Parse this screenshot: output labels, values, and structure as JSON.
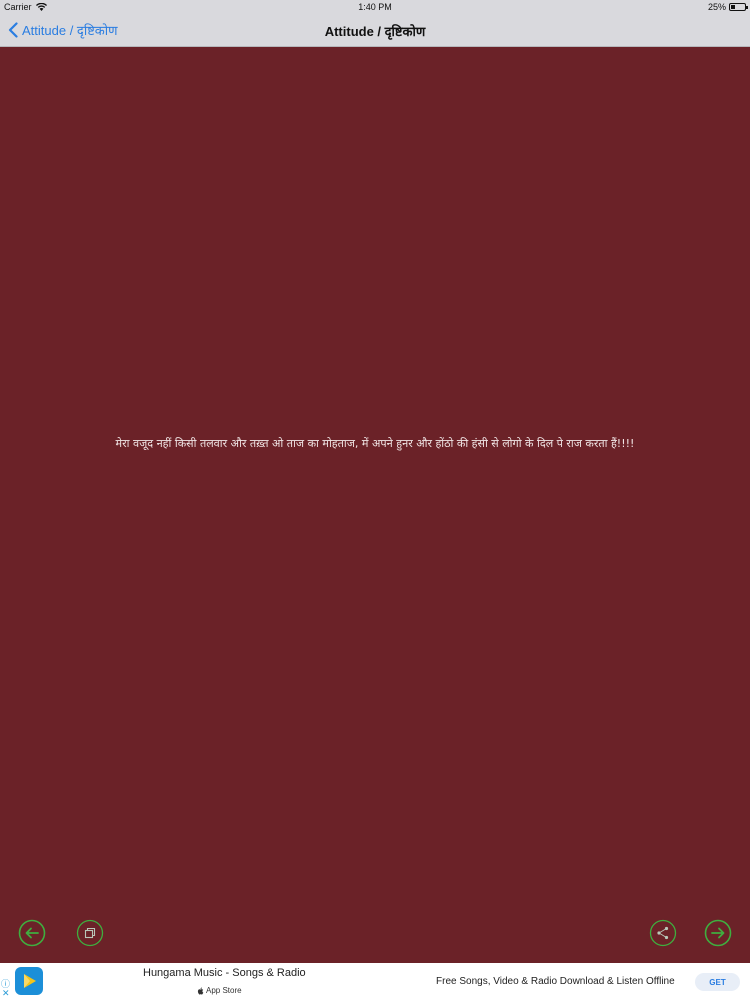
{
  "status_bar": {
    "carrier": "Carrier",
    "time": "1:40 PM",
    "battery_percent": "25%",
    "battery_level": 0.25
  },
  "nav": {
    "back_label": "Attitude / दृष्टिकोण",
    "title": "Attitude / दृष्टिकोण"
  },
  "content": {
    "quote": "मेरा वजूद नहीं किसी तलवार और तख़्त ओ ताज का मोहताज, में अपने हुनर और होंठो की हंसी से लोगो के दिल पे राज करता हैं!!!!",
    "background_color": "#6b2228",
    "text_color": "#f1e6e6"
  },
  "toolbar": {
    "prev_icon": "arrow-left-circle-icon",
    "copy_icon": "copy-icon",
    "share_icon": "share-icon",
    "next_icon": "arrow-right-circle-icon",
    "accent_color": "#3fae3f"
  },
  "ad": {
    "title": "Hungama Music - Songs & Radio",
    "store_label": "App Store",
    "description": "Free Songs, Video & Radio Download & Listen Offline",
    "cta": "GET"
  }
}
